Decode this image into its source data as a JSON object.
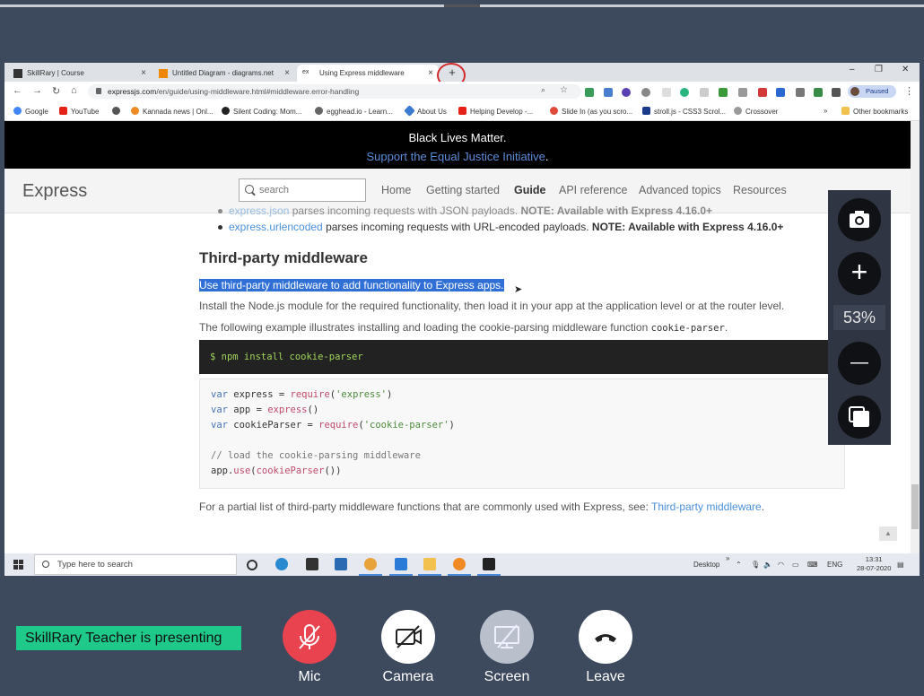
{
  "browser": {
    "tabs": [
      {
        "label": "SkillRary | Course",
        "close": "×"
      },
      {
        "label": "Untitled Diagram - diagrams.net",
        "close": "×"
      },
      {
        "label": "Using Express middleware",
        "close": "×"
      }
    ],
    "new_tab": "+",
    "window_controls": {
      "minimize": "–",
      "maximize": "❐",
      "close": "✕"
    },
    "url_host": "expressjs.com",
    "url_path": "/en/guide/using-middleware.html#middleware.error-handling",
    "profile_status": "Paused",
    "bookmarks": [
      "Google",
      "YouTube",
      "",
      "Kannada news | Onl...",
      "Silent Coding: Mom...",
      "egghead.io - Learn...",
      "About Us",
      "Helping Develop -...",
      "Slide In (as you scro...",
      "stroll.js - CSS3 Scrol...",
      "Crossover"
    ],
    "bookmarks_more": "»",
    "other_bookmarks": "Other bookmarks"
  },
  "page": {
    "banner_title": "Black Lives Matter.",
    "banner_link": "Support the Equal Justice Initiative",
    "banner_dot": ".",
    "logo": "Express",
    "search_placeholder": "search",
    "menu": [
      "Home",
      "Getting started",
      "Guide",
      "API reference",
      "Advanced topics",
      "Resources"
    ],
    "list_items": [
      {
        "link": "express.json",
        "text": " parses incoming requests with JSON payloads. ",
        "note": "NOTE: Available with Express 4.16.0+"
      },
      {
        "link": "express.urlencoded",
        "text": " parses incoming requests with URL-encoded payloads. ",
        "note": "NOTE: Available with Express 4.16.0+"
      }
    ],
    "heading": "Third-party middleware",
    "selected_text": "Use third-party middleware to add functionality to Express apps.",
    "para1": "Install the Node.js module for the required functionality, then load it in your app at the application level or at the router level.",
    "para2_start": "The following example illustrates installing and loading the cookie-parsing middleware function ",
    "para2_code": "cookie-parser",
    "para2_end": ".",
    "terminal": "$ npm install cookie-parser",
    "code": {
      "l1_kw": "var",
      "l1_a": " express = ",
      "l1_fn": "require",
      "l1_b": "(",
      "l1_st": "'express'",
      "l1_c": ")",
      "l2_kw": "var",
      "l2_a": " app = ",
      "l2_fn": "express",
      "l2_b": "()",
      "l3_kw": "var",
      "l3_a": " cookieParser = ",
      "l3_fn": "require",
      "l3_b": "(",
      "l3_st": "'cookie-parser'",
      "l3_c": ")",
      "l5_cm": "// load the cookie-parsing middleware",
      "l6_a": "app.",
      "l6_fn": "use",
      "l6_b": "(",
      "l6_fn2": "cookieParser",
      "l6_c": "())"
    },
    "para3": "For a partial list of third-party middleware functions that are commonly used with Express, see: ",
    "para3_link": "Third-party middleware",
    "para3_end": "."
  },
  "taskbar": {
    "search_placeholder": "Type here to search",
    "desktop_label": "Desktop",
    "chevron": "»",
    "language": "ENG",
    "time": "13:31",
    "date": "28-07-2020"
  },
  "zoom": {
    "level": "53%",
    "plus": "+",
    "minus": "—"
  },
  "meeting": {
    "presenting_text": "SkillRary Teacher is presenting",
    "controls": [
      "Mic",
      "Camera",
      "Screen",
      "Leave"
    ]
  },
  "colors": {
    "presenting_bg": "#1ec98a",
    "mic_bg": "#e8434f",
    "banner_link": "#5b8dd9",
    "selection": "#2f6fd6"
  }
}
